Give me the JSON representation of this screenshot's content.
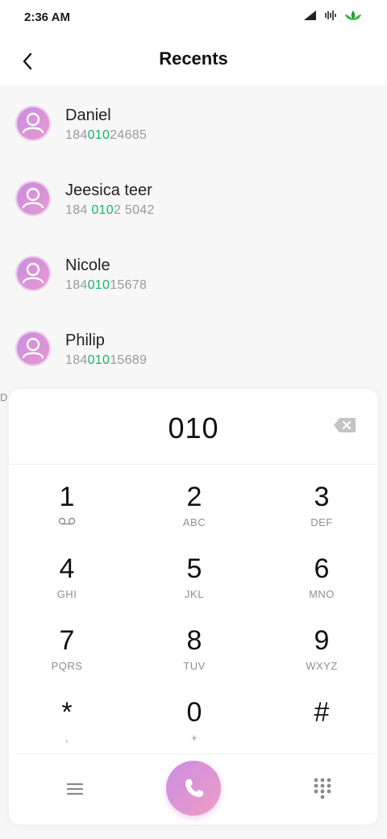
{
  "status": {
    "time": "2:36 AM"
  },
  "header": {
    "title": "Recents"
  },
  "recents": [
    {
      "name": "Daniel",
      "number_pre": "184",
      "number_match": "010",
      "number_post": "24685"
    },
    {
      "name": "Jeesica teer",
      "number_pre": "184 ",
      "number_match": "010",
      "number_post": "2 5042"
    },
    {
      "name": "Nicole",
      "number_pre": "184",
      "number_match": "010",
      "number_post": "15678"
    },
    {
      "name": "Philip",
      "number_pre": "184",
      "number_match": "010",
      "number_post": "15689"
    }
  ],
  "edge_letter": "D",
  "dialpad": {
    "entered": "010",
    "keys": [
      {
        "digit": "1",
        "letters": ""
      },
      {
        "digit": "2",
        "letters": "ABC"
      },
      {
        "digit": "3",
        "letters": "DEF"
      },
      {
        "digit": "4",
        "letters": "GHI"
      },
      {
        "digit": "5",
        "letters": "JKL"
      },
      {
        "digit": "6",
        "letters": "MNO"
      },
      {
        "digit": "7",
        "letters": "PQRS"
      },
      {
        "digit": "8",
        "letters": "TUV"
      },
      {
        "digit": "9",
        "letters": "WXYZ"
      },
      {
        "digit": "*",
        "letters": ","
      },
      {
        "digit": "0",
        "letters": "+"
      },
      {
        "digit": "#",
        "letters": ""
      }
    ]
  },
  "colors": {
    "match": "#19b46a",
    "accent_start": "#cc8de3",
    "accent_end": "#ee9dc4"
  },
  "icons": {
    "back": "chevron-left-icon",
    "backspace": "backspace-icon",
    "voicemail": "voicemail-icon",
    "menu": "menu-icon",
    "call": "phone-icon",
    "keypad": "keypad-icon"
  }
}
